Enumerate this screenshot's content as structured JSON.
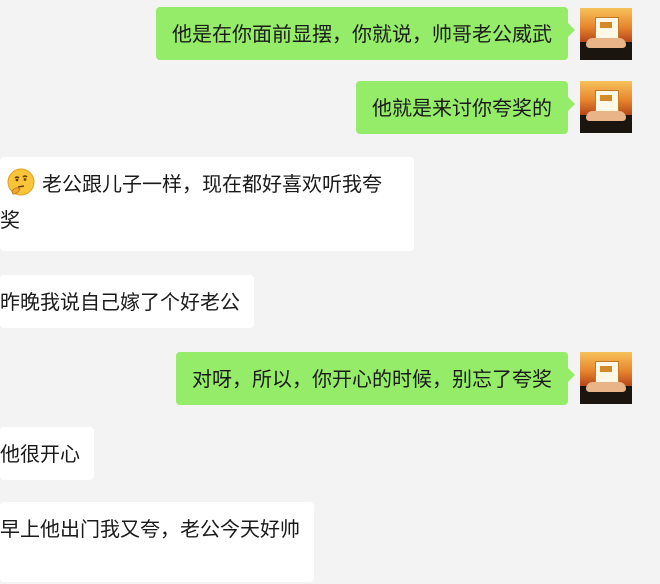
{
  "messages": [
    {
      "side": "out",
      "text": "他是在你面前显摆，你就说，帅哥老公威武"
    },
    {
      "side": "out",
      "text": "他就是来讨你夸奖的"
    },
    {
      "side": "in",
      "emoji": "thinking-face-emoji",
      "text": "老公跟儿子一样，现在都好喜欢听我夸奖"
    },
    {
      "side": "in",
      "text": "昨晚我说自己嫁了个好老公"
    },
    {
      "side": "out",
      "text": "对呀，所以，你开心的时候，别忘了夸奖"
    },
    {
      "side": "in",
      "text": "他很开心"
    },
    {
      "side": "in",
      "text": "早上他出门我又夸，老公今天好帅"
    }
  ],
  "colors": {
    "background": "#f3f3f3",
    "outgoing_bubble": "#95ec69",
    "incoming_bubble": "#ffffff"
  }
}
